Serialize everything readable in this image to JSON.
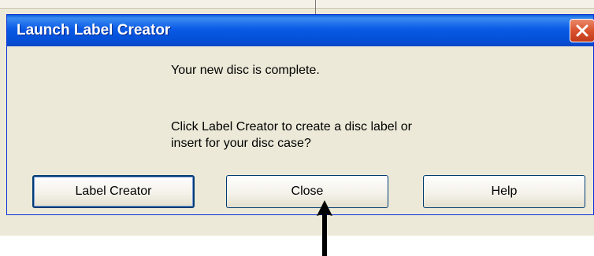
{
  "dialog": {
    "title": "Launch Label Creator",
    "message_line1": "Your new disc is complete.",
    "message_line2": "Click Label Creator to create a disc label or",
    "message_line3": "insert for your disc case?",
    "buttons": {
      "label_creator": "Label Creator",
      "close": "Close",
      "help": "Help"
    },
    "close_icon": "close-x-icon"
  },
  "colors": {
    "titlebar": "#0a5ae6",
    "dialog_bg": "#ece9d8",
    "close_button": "#d9532e",
    "arrow": "#000000"
  },
  "annotation": {
    "arrow_icon": "up-arrow-icon"
  }
}
